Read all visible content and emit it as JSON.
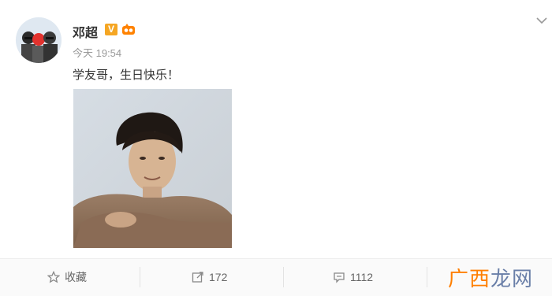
{
  "post": {
    "author": "邓超",
    "verified_badge": "V",
    "time": "今天 19:54",
    "text": "学友哥，生日快乐！"
  },
  "actions": {
    "favorite_label": "收藏",
    "repost_count": "172",
    "comment_count": "1112"
  },
  "watermark": {
    "part1": "广西",
    "part2": "龙网"
  },
  "icons": [
    "menu-chevron-icon",
    "star-icon",
    "repost-icon",
    "comment-icon",
    "fan-badge-icon"
  ],
  "colors": {
    "accent": "#f5a623",
    "watermark_orange": "#ff7f00",
    "watermark_blue": "#6a7fa8"
  }
}
